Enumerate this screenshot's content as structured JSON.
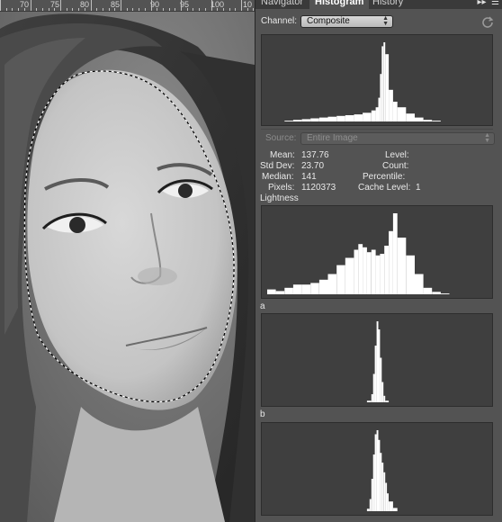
{
  "ruler": {
    "labels": [
      "70",
      "75",
      "80",
      "85",
      "90",
      "95",
      "100",
      "10"
    ]
  },
  "tabs": [
    {
      "label": "Navigator",
      "active": false
    },
    {
      "label": "Histogram",
      "active": true
    },
    {
      "label": "History",
      "active": false
    }
  ],
  "panel_menu_icon": "panel-menu-icon",
  "channel": {
    "label": "Channel:",
    "value": "Composite"
  },
  "source": {
    "label": "Source:",
    "value": "Entire Image",
    "disabled": true
  },
  "stats": {
    "mean": {
      "label": "Mean:",
      "value": "137.76"
    },
    "std_dev": {
      "label": "Std Dev:",
      "value": "23.70"
    },
    "median": {
      "label": "Median:",
      "value": "141"
    },
    "pixels": {
      "label": "Pixels:",
      "value": "1120373"
    },
    "level": {
      "label": "Level:",
      "value": ""
    },
    "count": {
      "label": "Count:",
      "value": ""
    },
    "percentile": {
      "label": "Percentile:",
      "value": ""
    },
    "cache_level": {
      "label": "Cache Level:",
      "value": "1"
    }
  },
  "channels": {
    "lightness": {
      "label": "Lightness"
    },
    "a": {
      "label": "a"
    },
    "b": {
      "label": "b"
    }
  },
  "colors": {
    "panel_bg": "#535353",
    "histogram_bg": "#3f3f3f",
    "histogram_fill": "#ffffff"
  },
  "chart_data": [
    {
      "type": "area",
      "channel": "Composite",
      "x": [
        0,
        10,
        20,
        30,
        40,
        50,
        60,
        70,
        80,
        90,
        100,
        110,
        120,
        125,
        128,
        130,
        132,
        134,
        136,
        140,
        145,
        150,
        160,
        170,
        180,
        190,
        200,
        210,
        220,
        230,
        240,
        250,
        255
      ],
      "values": [
        0,
        0,
        1,
        2,
        3,
        4,
        5,
        6,
        7,
        8,
        9,
        11,
        14,
        18,
        30,
        60,
        95,
        100,
        85,
        40,
        25,
        18,
        10,
        5,
        2,
        1,
        0,
        0,
        0,
        0,
        0,
        0,
        0
      ]
    },
    {
      "type": "area",
      "channel": "Lightness",
      "x": [
        0,
        10,
        20,
        30,
        40,
        50,
        60,
        70,
        80,
        90,
        100,
        105,
        110,
        115,
        120,
        125,
        130,
        135,
        140,
        145,
        150,
        160,
        170,
        180,
        190,
        200,
        210,
        220,
        230,
        240,
        255
      ],
      "values": [
        6,
        4,
        8,
        12,
        12,
        14,
        18,
        25,
        36,
        45,
        55,
        62,
        58,
        52,
        55,
        48,
        50,
        60,
        78,
        100,
        70,
        48,
        25,
        8,
        3,
        1,
        0,
        0,
        0,
        0,
        0
      ]
    },
    {
      "type": "area",
      "channel": "a",
      "x": [
        0,
        100,
        110,
        115,
        120,
        122,
        124,
        126,
        128,
        130,
        132,
        134,
        136,
        140,
        150,
        255
      ],
      "values": [
        0,
        0,
        0,
        2,
        10,
        35,
        70,
        100,
        90,
        55,
        25,
        8,
        2,
        0,
        0,
        0
      ]
    },
    {
      "type": "area",
      "channel": "b",
      "x": [
        0,
        100,
        110,
        115,
        118,
        120,
        122,
        124,
        126,
        128,
        130,
        132,
        134,
        136,
        138,
        140,
        145,
        150,
        255
      ],
      "values": [
        0,
        0,
        0,
        3,
        15,
        40,
        70,
        95,
        100,
        88,
        72,
        60,
        48,
        35,
        22,
        12,
        4,
        0,
        0
      ]
    }
  ]
}
